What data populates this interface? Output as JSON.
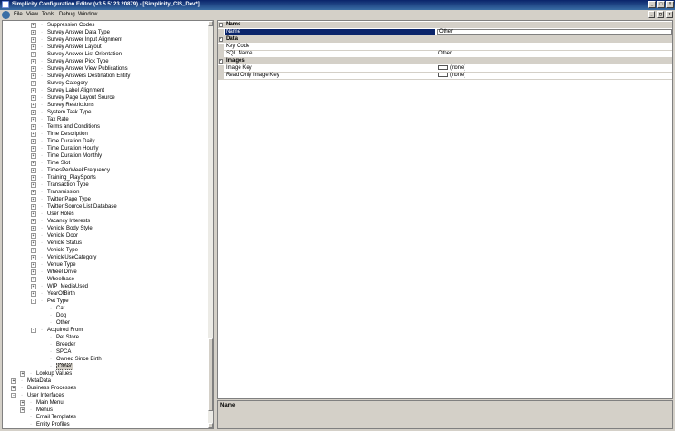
{
  "window": {
    "title": "Simplicity Configuration Editor (v3.5.5123.20879) - [Simplicity_CIS_Dev*]",
    "minimize": "_",
    "maximize": "□",
    "close": "x"
  },
  "menu": {
    "items": [
      "File",
      "View",
      "Tools",
      "Debug",
      "Window"
    ],
    "mdi_minimize": "_",
    "mdi_restore": "◻",
    "mdi_close": "x"
  },
  "tree": {
    "rows": [
      {
        "label": "Suppression Codes",
        "level": 2,
        "expander": "+"
      },
      {
        "label": "Survey Answer Data Type",
        "level": 2,
        "expander": "+"
      },
      {
        "label": "Survey Answer Input Alignment",
        "level": 2,
        "expander": "+"
      },
      {
        "label": "Survey Answer Layout",
        "level": 2,
        "expander": "+"
      },
      {
        "label": "Survey Answer List Orientation",
        "level": 2,
        "expander": "+"
      },
      {
        "label": "Survey Answer Pick Type",
        "level": 2,
        "expander": "+"
      },
      {
        "label": "Survey Answer View Publications",
        "level": 2,
        "expander": "+"
      },
      {
        "label": "Survey Answers Destination Entity",
        "level": 2,
        "expander": "+"
      },
      {
        "label": "Survey Category",
        "level": 2,
        "expander": "+"
      },
      {
        "label": "Survey Label Alignment",
        "level": 2,
        "expander": "+"
      },
      {
        "label": "Survey Page Layout Source",
        "level": 2,
        "expander": "+"
      },
      {
        "label": "Survey Restrictions",
        "level": 2,
        "expander": "+"
      },
      {
        "label": "System Task Type",
        "level": 2,
        "expander": "+"
      },
      {
        "label": "Tax Rate",
        "level": 2,
        "expander": "+"
      },
      {
        "label": "Terms and Conditions",
        "level": 2,
        "expander": "+"
      },
      {
        "label": "Time Description",
        "level": 2,
        "expander": "+"
      },
      {
        "label": "Time Duration Daily",
        "level": 2,
        "expander": "+"
      },
      {
        "label": "Time Duration Hourly",
        "level": 2,
        "expander": "+"
      },
      {
        "label": "Time Duration Monthly",
        "level": 2,
        "expander": "+"
      },
      {
        "label": "Time Slot",
        "level": 2,
        "expander": "+"
      },
      {
        "label": "TimesPerWeekFrequency",
        "level": 2,
        "expander": "+"
      },
      {
        "label": "Training_PlaySports",
        "level": 2,
        "expander": "+"
      },
      {
        "label": "Transaction Type",
        "level": 2,
        "expander": "+"
      },
      {
        "label": "Transmission",
        "level": 2,
        "expander": "+"
      },
      {
        "label": "Twitter Page Type",
        "level": 2,
        "expander": "+"
      },
      {
        "label": "Twitter Source List Database",
        "level": 2,
        "expander": "+"
      },
      {
        "label": "User Roles",
        "level": 2,
        "expander": "+"
      },
      {
        "label": "Vacancy Interests",
        "level": 2,
        "expander": "+"
      },
      {
        "label": "Vehicle Body Style",
        "level": 2,
        "expander": "+"
      },
      {
        "label": "Vehicle Door",
        "level": 2,
        "expander": "+"
      },
      {
        "label": "Vehicle Status",
        "level": 2,
        "expander": "+"
      },
      {
        "label": "Vehicle Type",
        "level": 2,
        "expander": "+"
      },
      {
        "label": "VehicleUseCategory",
        "level": 2,
        "expander": "+"
      },
      {
        "label": "Venue Type",
        "level": 2,
        "expander": "+"
      },
      {
        "label": "Wheel Drive",
        "level": 2,
        "expander": "+"
      },
      {
        "label": "Wheelbase",
        "level": 2,
        "expander": "+"
      },
      {
        "label": "WIP_MediaUsed",
        "level": 2,
        "expander": "+"
      },
      {
        "label": "YearOfBirth",
        "level": 2,
        "expander": "+"
      },
      {
        "label": "Pet Type",
        "level": 2,
        "expander": "-"
      },
      {
        "label": "Cat",
        "level": 3,
        "expander": ""
      },
      {
        "label": "Dog",
        "level": 3,
        "expander": ""
      },
      {
        "label": "Other",
        "level": 3,
        "expander": ""
      },
      {
        "label": "Acquired From",
        "level": 2,
        "expander": "-"
      },
      {
        "label": "Pet Store",
        "level": 3,
        "expander": ""
      },
      {
        "label": "Breeder",
        "level": 3,
        "expander": ""
      },
      {
        "label": "SPCA",
        "level": 3,
        "expander": ""
      },
      {
        "label": "Owned Since Birth",
        "level": 3,
        "expander": ""
      },
      {
        "label": "Other",
        "level": 3,
        "expander": "",
        "selected": true
      },
      {
        "label": "Lookup Values",
        "level": 1,
        "expander": "+"
      },
      {
        "label": "MetaData",
        "level": 0,
        "expander": "+"
      },
      {
        "label": "Business Processes",
        "level": 0,
        "expander": "+"
      },
      {
        "label": "User Interfaces",
        "level": 0,
        "expander": "-"
      },
      {
        "label": "Main Menu",
        "level": 1,
        "expander": "+"
      },
      {
        "label": "Menus",
        "level": 1,
        "expander": "+"
      },
      {
        "label": "Email Templates",
        "level": 1,
        "expander": ""
      },
      {
        "label": "Entity Profiles",
        "level": 1,
        "expander": ""
      }
    ]
  },
  "properties": {
    "categories": [
      {
        "label": "Name",
        "expander": "-",
        "rows": [
          {
            "name": "Name",
            "value": "Other",
            "selected": true
          }
        ]
      },
      {
        "label": "Data",
        "expander": "-",
        "rows": [
          {
            "name": "Key Code",
            "value": ""
          },
          {
            "name": "SQL Name",
            "value": "Other"
          }
        ]
      },
      {
        "label": "Images",
        "expander": "-",
        "rows": [
          {
            "name": "Image Key",
            "value": "(none)",
            "swatch": true
          },
          {
            "name": "Read Only Image Key",
            "value": "(none)",
            "swatch": true
          }
        ]
      }
    ]
  },
  "description": {
    "title": "Name"
  }
}
